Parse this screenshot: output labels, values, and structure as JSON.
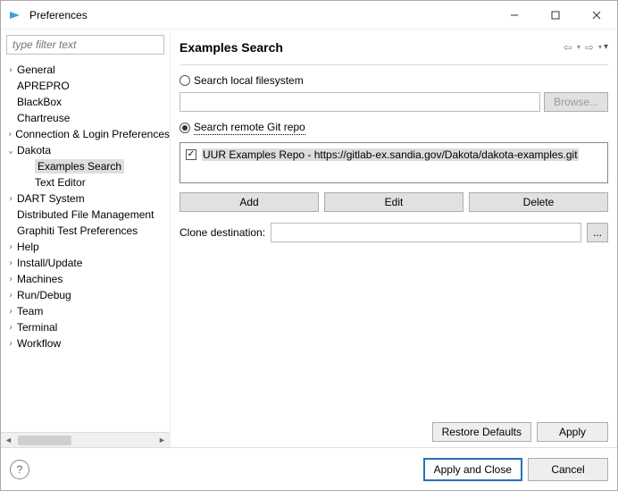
{
  "window": {
    "title": "Preferences"
  },
  "filter": {
    "placeholder": "type filter text"
  },
  "tree": {
    "items": [
      {
        "label": "General",
        "expandable": true,
        "level": 0
      },
      {
        "label": "APREPRO",
        "expandable": false,
        "level": 0
      },
      {
        "label": "BlackBox",
        "expandable": false,
        "level": 0
      },
      {
        "label": "Chartreuse",
        "expandable": false,
        "level": 0
      },
      {
        "label": "Connection & Login Preferences",
        "expandable": true,
        "level": 0
      },
      {
        "label": "Dakota",
        "expandable": true,
        "expanded": true,
        "level": 0
      },
      {
        "label": "Examples Search",
        "expandable": false,
        "level": 1,
        "selected": true
      },
      {
        "label": "Text Editor",
        "expandable": false,
        "level": 1
      },
      {
        "label": "DART System",
        "expandable": true,
        "level": 0
      },
      {
        "label": "Distributed File Management",
        "expandable": false,
        "level": 0
      },
      {
        "label": "Graphiti Test Preferences",
        "expandable": false,
        "level": 0
      },
      {
        "label": "Help",
        "expandable": true,
        "level": 0
      },
      {
        "label": "Install/Update",
        "expandable": true,
        "level": 0
      },
      {
        "label": "Machines",
        "expandable": true,
        "level": 0
      },
      {
        "label": "Run/Debug",
        "expandable": true,
        "level": 0
      },
      {
        "label": "Team",
        "expandable": true,
        "level": 0
      },
      {
        "label": "Terminal",
        "expandable": true,
        "level": 0
      },
      {
        "label": "Workflow",
        "expandable": true,
        "level": 0
      }
    ]
  },
  "page": {
    "title": "Examples Search",
    "radio_local": "Search local filesystem",
    "browse": "Browse...",
    "radio_remote": "Search remote Git repo",
    "selected_radio": "remote",
    "repo_item": "UUR Examples Repo - https://gitlab-ex.sandia.gov/Dakota/dakota-examples.git",
    "add": "Add",
    "edit": "Edit",
    "delete": "Delete",
    "clone_label": "Clone destination:",
    "dots": "...",
    "restore": "Restore Defaults",
    "apply": "Apply"
  },
  "footer": {
    "help_tooltip": "?",
    "apply_close": "Apply and Close",
    "cancel": "Cancel"
  }
}
